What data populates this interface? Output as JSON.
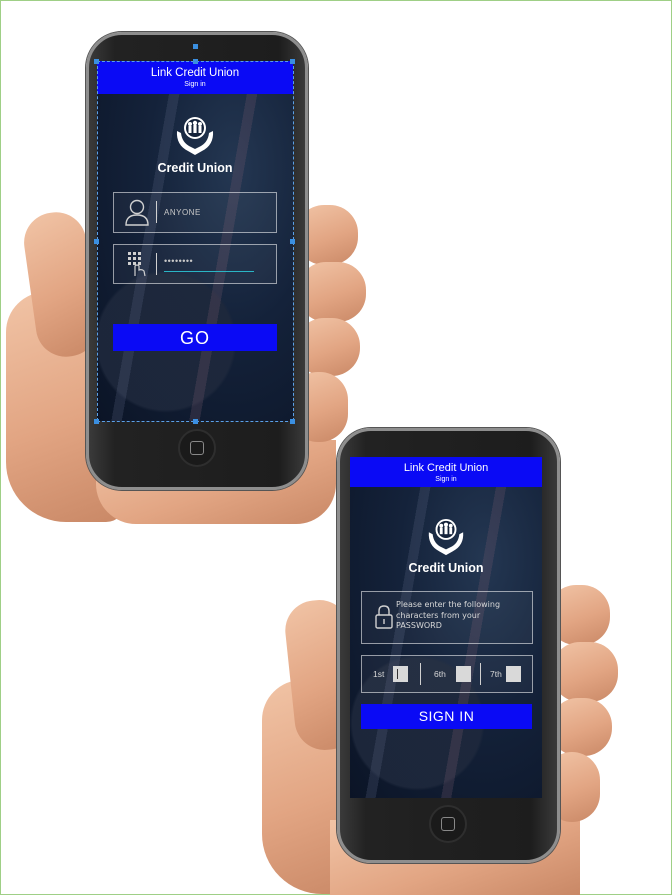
{
  "screens": [
    {
      "title": "Link Credit Union",
      "subtitle": "Sign in",
      "brand": "Credit Union",
      "username_value": "ANYONE",
      "password_value": "••••••••",
      "go_label": "GO"
    },
    {
      "title": "Link Credit Union",
      "subtitle": "Sign in",
      "brand": "Credit Union",
      "instructions": "Please enter the following characters from your PASSWORD",
      "positions": [
        "1st",
        "6th",
        "7th"
      ],
      "signin_label": "SIGN IN"
    }
  ],
  "colors": {
    "titlebar": "#0a0af5",
    "button": "#0a0af5",
    "screen_bg": "#14223a",
    "input_accent": "#2ab5c5"
  },
  "icons": [
    "user-icon",
    "keypad-icon",
    "lock-icon",
    "credit-union-logo"
  ]
}
